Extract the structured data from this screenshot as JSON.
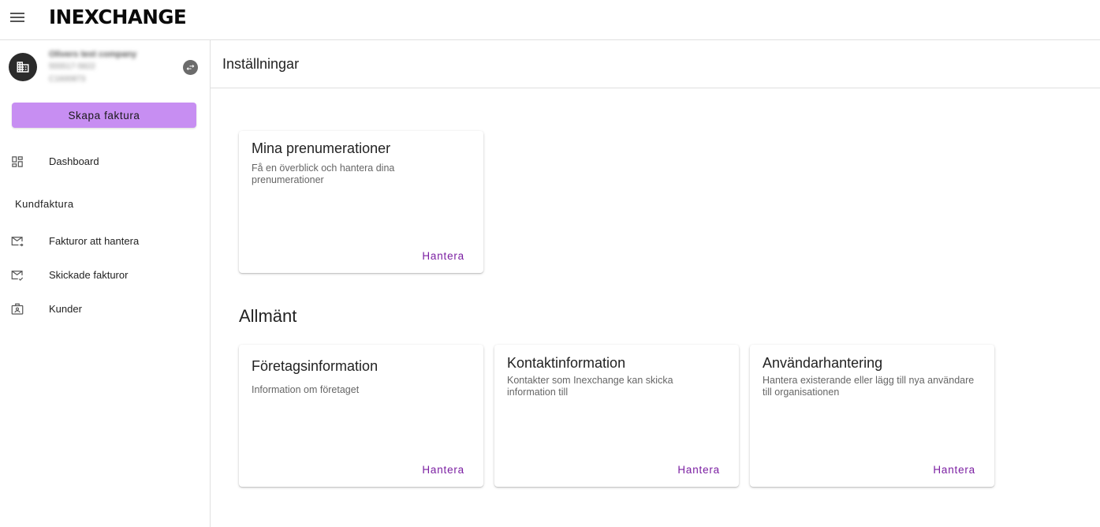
{
  "header": {
    "logo_text": "INEXCHANGE",
    "menu_icon": "hamburger-menu-icon"
  },
  "sidebar": {
    "company": {
      "name": "Olivers test company",
      "org_number": "555517-5822",
      "id": "C1600873",
      "avatar_icon": "building-icon",
      "switch_icon": "swap-icon"
    },
    "create_button": "Skapa faktura",
    "dashboard": {
      "label": "Dashboard",
      "icon": "dashboard-icon"
    },
    "section_title": "Kundfaktura",
    "items": [
      {
        "label": "Fakturor att hantera",
        "icon": "mail-forward-icon"
      },
      {
        "label": "Skickade fakturor",
        "icon": "mail-check-icon"
      },
      {
        "label": "Kunder",
        "icon": "contact-card-icon"
      }
    ]
  },
  "main": {
    "title": "Inställningar",
    "subscriptions_card": {
      "title": "Mina prenumerationer",
      "description": "Få en överblick och hantera dina prenumerationer",
      "action": "Hantera"
    },
    "general_heading": "Allmänt",
    "general_cards": [
      {
        "title": "Företagsinformation",
        "description": "Information om företaget",
        "action": "Hantera"
      },
      {
        "title": "Kontaktinformation",
        "description": "Kontakter som Inexchange kan skicka information till",
        "action": "Hantera"
      },
      {
        "title": "Användarhantering",
        "description": "Hantera existerande eller lägg till nya användare till organisationen",
        "action": "Hantera"
      }
    ]
  },
  "colors": {
    "accent": "#7b1fa2",
    "create_button_bg": "#c78ef2",
    "avatar_bg": "#2b2b2b"
  }
}
